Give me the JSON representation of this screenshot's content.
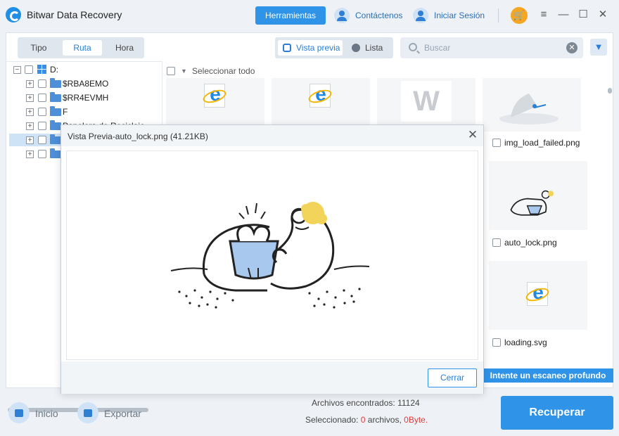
{
  "app": {
    "title": "Bitwar Data Recovery",
    "tools_button": "Herramientas",
    "contact": "Contáctenos",
    "login": "Iniciar Sesión"
  },
  "tabs": [
    "Tipo",
    "Ruta",
    "Hora"
  ],
  "active_tab": "Ruta",
  "view": {
    "preview": "Vista previa",
    "list": "Lista",
    "active": "Vista previa"
  },
  "search": {
    "placeholder": "Buscar",
    "value": ""
  },
  "tree": {
    "root": "D:",
    "children": [
      "$RBA8EMO",
      "$RR4EVMH",
      "F",
      "Papelera de Reciclaje",
      "",
      ""
    ]
  },
  "content": {
    "select_all": "Seleccionar todo",
    "files": [
      {
        "name": "img_load_failed.png"
      },
      {
        "name": "auto_lock.png"
      },
      {
        "name": "loading.svg"
      }
    ]
  },
  "deep_scan": "Intente un escaneo profundo",
  "preview_modal": {
    "title": "Vista Previa-auto_lock.png (41.21KB)",
    "close_button": "Cerrar"
  },
  "bottom": {
    "home": "Inicio",
    "export": "Exportar",
    "found_label": "Archivos encontrados:",
    "found_count": "11124",
    "selected_label": "Seleccionado:",
    "selected_count": "0",
    "files_word": "archivos,",
    "selected_size": "0Byte.",
    "recover": "Recuperar"
  },
  "colors": {
    "accent": "#2f93e8",
    "highlight": "#e43b3b",
    "cart": "#f5a623"
  }
}
